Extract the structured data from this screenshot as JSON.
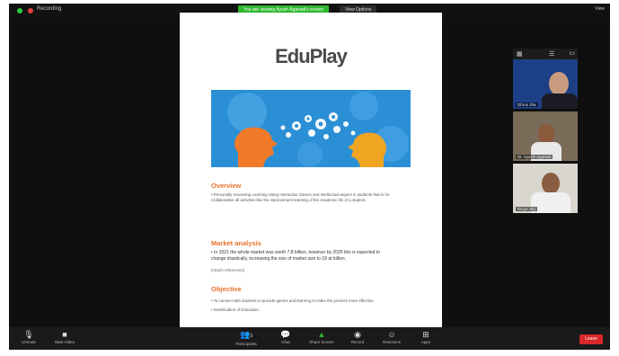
{
  "topbar": {
    "meeting_label": "Recording",
    "share_banner": "You are viewing Ayush Agarwal's screen",
    "view_options": "View Options",
    "view_button": "View"
  },
  "document": {
    "logo": "EduPlay",
    "sections": [
      {
        "heading": "Overview",
        "lines": [
          "• Personally Assessing Learning Using Interactive Games and Intellectual aspect in students that is for",
          "Collaborative all activities like the improvement learning of the Academic life of a student."
        ]
      },
      {
        "heading": "Market analysis",
        "lines": [
          "• In 2021 the whole market was worth 7.8 billion, however by 2025 this is expected to",
          "change drastically, increasing the size of market size to 18 at billion.",
          "[Attach references]"
        ]
      },
      {
        "heading": "Objective",
        "lines": [
          "• To connect with students to provide games and learning to make the process more effective.",
          "• Gamification of Education."
        ]
      }
    ]
  },
  "participants": [
    {
      "name": "Dhruv Jha",
      "tile_label": "Dhruv Jha"
    },
    {
      "name": "Ayushi Agarwal",
      "tile_label": "Dr. Ayushi Agarwal"
    },
    {
      "name": "Divya Jha",
      "tile_label": "Divya Jha"
    }
  ],
  "toolbar": {
    "unmute": "Unmute",
    "start_video": "Start Video",
    "participants": "Participants",
    "participants_count": "3",
    "chat": "Chat",
    "share_screen": "Share Screen",
    "record": "Record",
    "reactions": "Reactions",
    "apps": "Apps",
    "leave": "Leave"
  },
  "colors": {
    "accent": "#e8712a",
    "share_green": "#2eb82e",
    "leave_red": "#d9262a"
  }
}
